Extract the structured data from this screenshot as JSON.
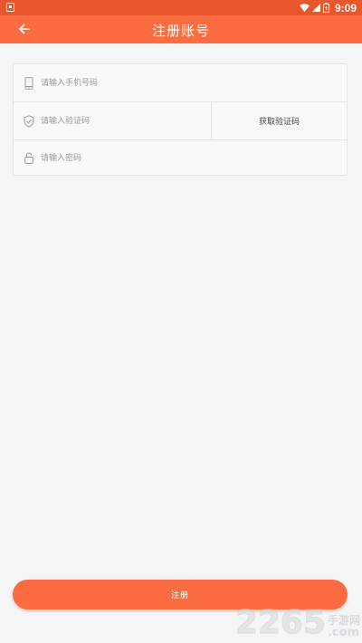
{
  "status_bar": {
    "time": "9:09",
    "icons": [
      "notification-icon",
      "wifi-icon",
      "signal-icon",
      "battery-icon"
    ]
  },
  "header": {
    "title": "注册账号",
    "back_icon": "back-arrow-icon"
  },
  "form": {
    "phone": {
      "placeholder": "请输入手机号码",
      "value": "",
      "icon": "phone-icon"
    },
    "code": {
      "placeholder": "请输入验证码",
      "value": "",
      "icon": "shield-icon",
      "button_label": "获取验证码"
    },
    "password": {
      "placeholder": "请输入密码",
      "value": "",
      "icon": "lock-icon"
    }
  },
  "submit_label": "注册",
  "watermark": {
    "number": "2265",
    "cn": "手游网",
    "domain": ".com"
  },
  "colors": {
    "accent": "#fb6d41",
    "status_bar": "#e8572c",
    "background": "#f4f5f7"
  }
}
